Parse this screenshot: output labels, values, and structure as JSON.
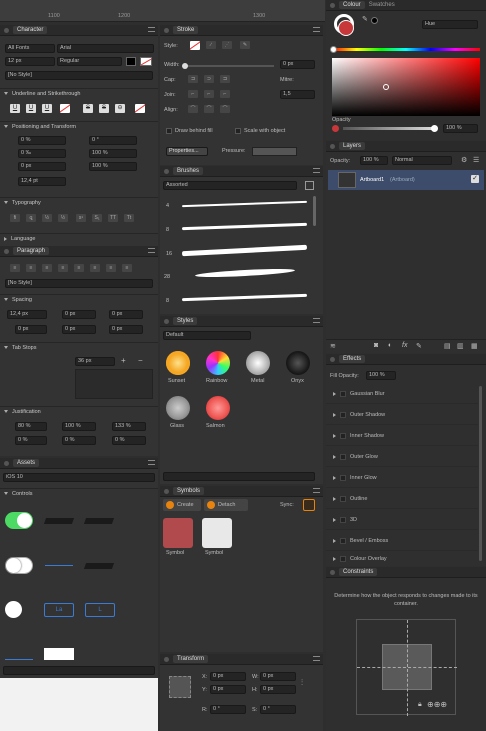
{
  "ruler": {
    "marks": [
      "1100",
      "1200",
      "1300"
    ]
  },
  "character": {
    "title": "Character",
    "font_set": "All Fonts",
    "font": "Arial",
    "size": "12 px",
    "weight": "Regular",
    "style": "[No Style]",
    "underline_section": "Underline and Strikethrough",
    "positioning_section": "Positioning and Transform",
    "pos_fields": [
      "0 %",
      "0 ‰",
      "0 px",
      "12,4 pt"
    ],
    "pos_fields_right": [
      "0 °",
      "100 %",
      "100 %"
    ],
    "typography_section": "Typography",
    "language_section": "Language"
  },
  "stroke": {
    "title": "Stroke",
    "style_label": "Style:",
    "width_label": "Width:",
    "width_value": "0 px",
    "cap_label": "Cap:",
    "join_label": "Join:",
    "mitre_label": "Mitre:",
    "mitre_value": "1,5",
    "align_label": "Align:",
    "draw_behind": "Draw behind fill",
    "scale_with": "Scale with object",
    "properties_btn": "Properties...",
    "pressure_label": "Pressure:"
  },
  "brushes": {
    "title": "Brushes",
    "category": "Assorted",
    "sizes": [
      "4",
      "8",
      "16",
      "28",
      "8"
    ]
  },
  "paragraph": {
    "title": "Paragraph",
    "style": "[No Style]",
    "spacing_section": "Spacing",
    "spacing_fields": [
      "12,4 px",
      "0 px",
      "0 px",
      "0 px",
      "0 px",
      "0 px"
    ],
    "tabstops_section": "Tab Stops",
    "tab_value": "36 px",
    "justification_section": "Justification",
    "just_fields": [
      "80 %",
      "100 %",
      "133 %",
      "0 %",
      "0 %",
      "0 %"
    ]
  },
  "styles": {
    "title": "Styles",
    "category": "Default",
    "items": [
      {
        "name": "Sunset",
        "color": "#f5a623"
      },
      {
        "name": "Rainbow",
        "color": "#e94f8a"
      },
      {
        "name": "Metal",
        "color": "#bdbdbd"
      },
      {
        "name": "Onyx",
        "color": "#1c1c1c"
      },
      {
        "name": "Glass",
        "color": "#9a9a9a"
      },
      {
        "name": "Salmon",
        "color": "#ef5a55"
      }
    ]
  },
  "assets": {
    "title": "Assets",
    "set": "iOS 10",
    "group": "Controls"
  },
  "symbols": {
    "title": "Symbols",
    "create_btn": "Create",
    "detach_btn": "Detach",
    "sync_label": "Sync:",
    "items": [
      {
        "name": "Symbol",
        "color": "#b04a4c"
      },
      {
        "name": "Symbol",
        "color": "#e8e8e8"
      }
    ]
  },
  "transform": {
    "title": "Transform",
    "x_label": "X:",
    "x_value": "0 px",
    "y_label": "Y:",
    "y_value": "0 px",
    "w_label": "W:",
    "w_value": "0 px",
    "h_label": "H:",
    "h_value": "0 px",
    "r_label": "R:",
    "r_value": "0 °",
    "s_label": "S:",
    "s_value": "0 °"
  },
  "colour": {
    "tab1": "Colour",
    "tab2": "Swatches",
    "model": "Hue",
    "opacity_label": "Opacity",
    "opacity_value": "100 %",
    "current_color": "#c8373a"
  },
  "layers": {
    "title": "Layers",
    "opacity_label": "Opacity:",
    "opacity_value": "100 %",
    "blend": "Normal",
    "layer_name": "Artboard1",
    "layer_type": "(Artboard)"
  },
  "effects": {
    "title": "Effects",
    "fill_opacity_label": "Fill Opacity:",
    "fill_opacity_value": "100 %",
    "items": [
      "Gaussian Blur",
      "Outer Shadow",
      "Inner Shadow",
      "Outer Glow",
      "Inner Glow",
      "Outline",
      "3D",
      "Bevel / Emboss",
      "Colour Overlay"
    ]
  },
  "constraints": {
    "title": "Constraints",
    "description": "Determine how the object responds to changes made to its container."
  }
}
